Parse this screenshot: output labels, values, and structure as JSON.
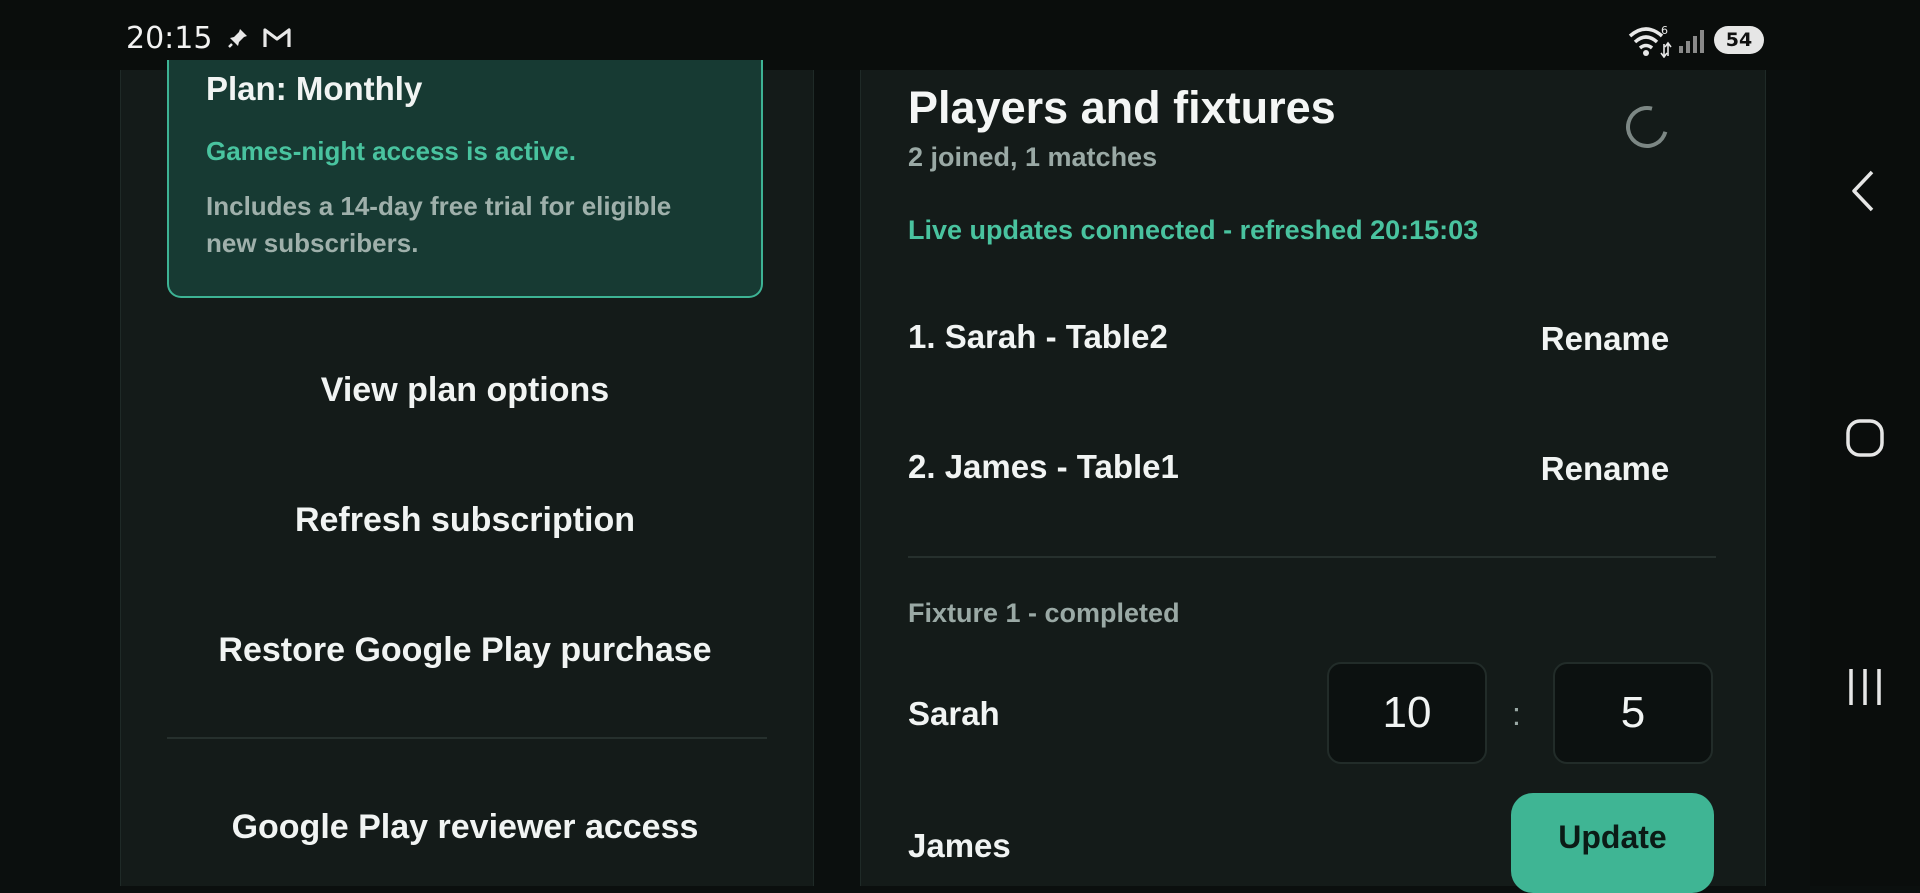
{
  "status_bar": {
    "time": "20:15",
    "notification_icons": [
      "pin-icon",
      "gmail-icon"
    ],
    "wifi_badge": "6",
    "battery": "54"
  },
  "subscription": {
    "plan_title": "Plan: Monthly",
    "status_text": "Games-night access is active.",
    "trial_note": "Includes a 14-day free trial for eligible new subscribers.",
    "view_plan_label": "View plan options",
    "refresh_label": "Refresh subscription",
    "restore_label": "Restore Google Play purchase",
    "reviewer_label": "Google Play reviewer access"
  },
  "players": {
    "title": "Players and fixtures",
    "subtitle": "2 joined, 1 matches",
    "live_status": "Live updates connected - refreshed 20:15:03",
    "list": [
      {
        "label": "1. Sarah - Table2",
        "action": "Rename"
      },
      {
        "label": "2. James - Table1",
        "action": "Rename"
      }
    ]
  },
  "fixture": {
    "title": "Fixture 1 - completed",
    "home": "Sarah",
    "away": "James",
    "home_score": "10",
    "away_score": "5",
    "separator": ":",
    "update_label": "Update"
  },
  "colors": {
    "accent": "#3fb594",
    "accent_text": "#49c39f",
    "background": "#0b0f0e",
    "panel": "#141b19",
    "card": "#173a33"
  }
}
